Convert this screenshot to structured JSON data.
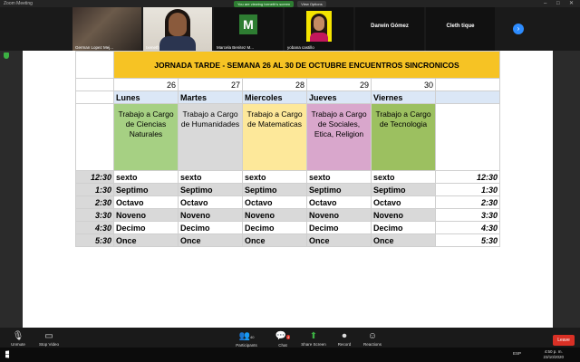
{
  "window": {
    "title": "Zoom Meeting"
  },
  "banner": {
    "viewing_text": "You are viewing Ixeneth's screen",
    "view_options": "View Options"
  },
  "participants": [
    {
      "name": "German Lopez Mej...",
      "kind": "photo-man"
    },
    {
      "name": "Ixeneth",
      "kind": "photo-woman",
      "active": true
    },
    {
      "name": "Marcela Benitez M...",
      "kind": "avatar-M",
      "initial": "M"
    },
    {
      "name": "yobana castillo",
      "kind": "photo-yellow"
    },
    {
      "name": "Darwin Gómez",
      "kind": "name-only"
    },
    {
      "name": "Cleth tique",
      "kind": "name-only"
    }
  ],
  "schedule": {
    "title": "JORNADA TARDE - SEMANA 26 AL 30 DE OCTUBRE ENCUENTROS SINCRONICOS",
    "dates": [
      "26",
      "27",
      "28",
      "29",
      "30"
    ],
    "days": [
      "Lunes",
      "Martes",
      "Miercoles",
      "Jueves",
      "Viernes"
    ],
    "subjects": [
      "Trabajo a Cargo de Ciencias Naturales",
      "Trabajo a Cargo de Humanidades",
      "Trabajo a Cargo de Matematicas",
      "Trabajo a Cargo de Sociales, Etica, Religion",
      "Trabajo a Cargo de Tecnologia"
    ],
    "rows": [
      {
        "time": "12:30",
        "cells": [
          "sexto",
          "sexto",
          "sexto",
          "sexto",
          "sexto"
        ],
        "time_right": "12:30"
      },
      {
        "time": "1:30",
        "cells": [
          "Septimo",
          "Septimo",
          "Septimo",
          "Septimo",
          "Septimo"
        ],
        "time_right": "1:30"
      },
      {
        "time": "2:30",
        "cells": [
          "Octavo",
          "Octavo",
          "Octavo",
          "Octavo",
          "Octavo"
        ],
        "time_right": "2:30"
      },
      {
        "time": "3:30",
        "cells": [
          "Noveno",
          "Noveno",
          "Noveno",
          "Noveno",
          "Noveno"
        ],
        "time_right": "3:30"
      },
      {
        "time": "4:30",
        "cells": [
          "Decimo",
          "Decimo",
          "Decimo",
          "Decimo",
          "Decimo"
        ],
        "time_right": "4:30"
      },
      {
        "time": "5:30",
        "cells": [
          "Once",
          "Once",
          "Once",
          "Once",
          "Once"
        ],
        "time_right": "5:30"
      }
    ]
  },
  "toolbar": {
    "unmute": "Unmute",
    "stop_video": "Stop Video",
    "participants": "Participants",
    "participants_count": "40",
    "chat": "Chat",
    "chat_badge": "4",
    "share_screen": "Share Screen",
    "record": "Record",
    "reactions": "Reactions",
    "leave": "Leave"
  },
  "taskbar": {
    "time": "4:50 p. m.",
    "date": "23/10/2020",
    "lang": "ESP"
  }
}
